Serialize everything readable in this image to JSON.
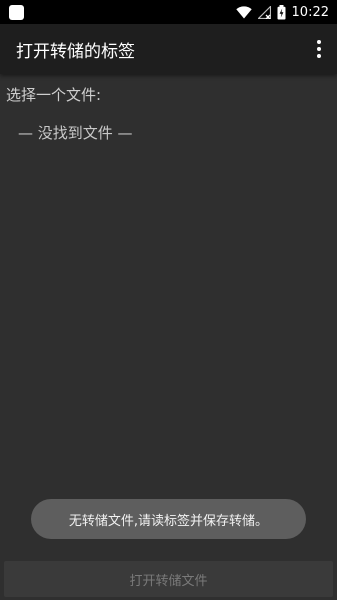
{
  "status_bar": {
    "time": "10:22",
    "icons": [
      "notification-icon",
      "wifi-icon",
      "signal-icon",
      "battery-charging-icon"
    ]
  },
  "app_bar": {
    "title": "打开转储的标签",
    "menu_icon": "more-vert-icon"
  },
  "main": {
    "prompt": "选择一个文件:",
    "file_list": [
      "— 没找到文件 —"
    ]
  },
  "toast": {
    "message": "无转储文件,请读标签并保存转储。"
  },
  "footer": {
    "open_button_label": "打开转储文件",
    "open_button_enabled": false
  }
}
